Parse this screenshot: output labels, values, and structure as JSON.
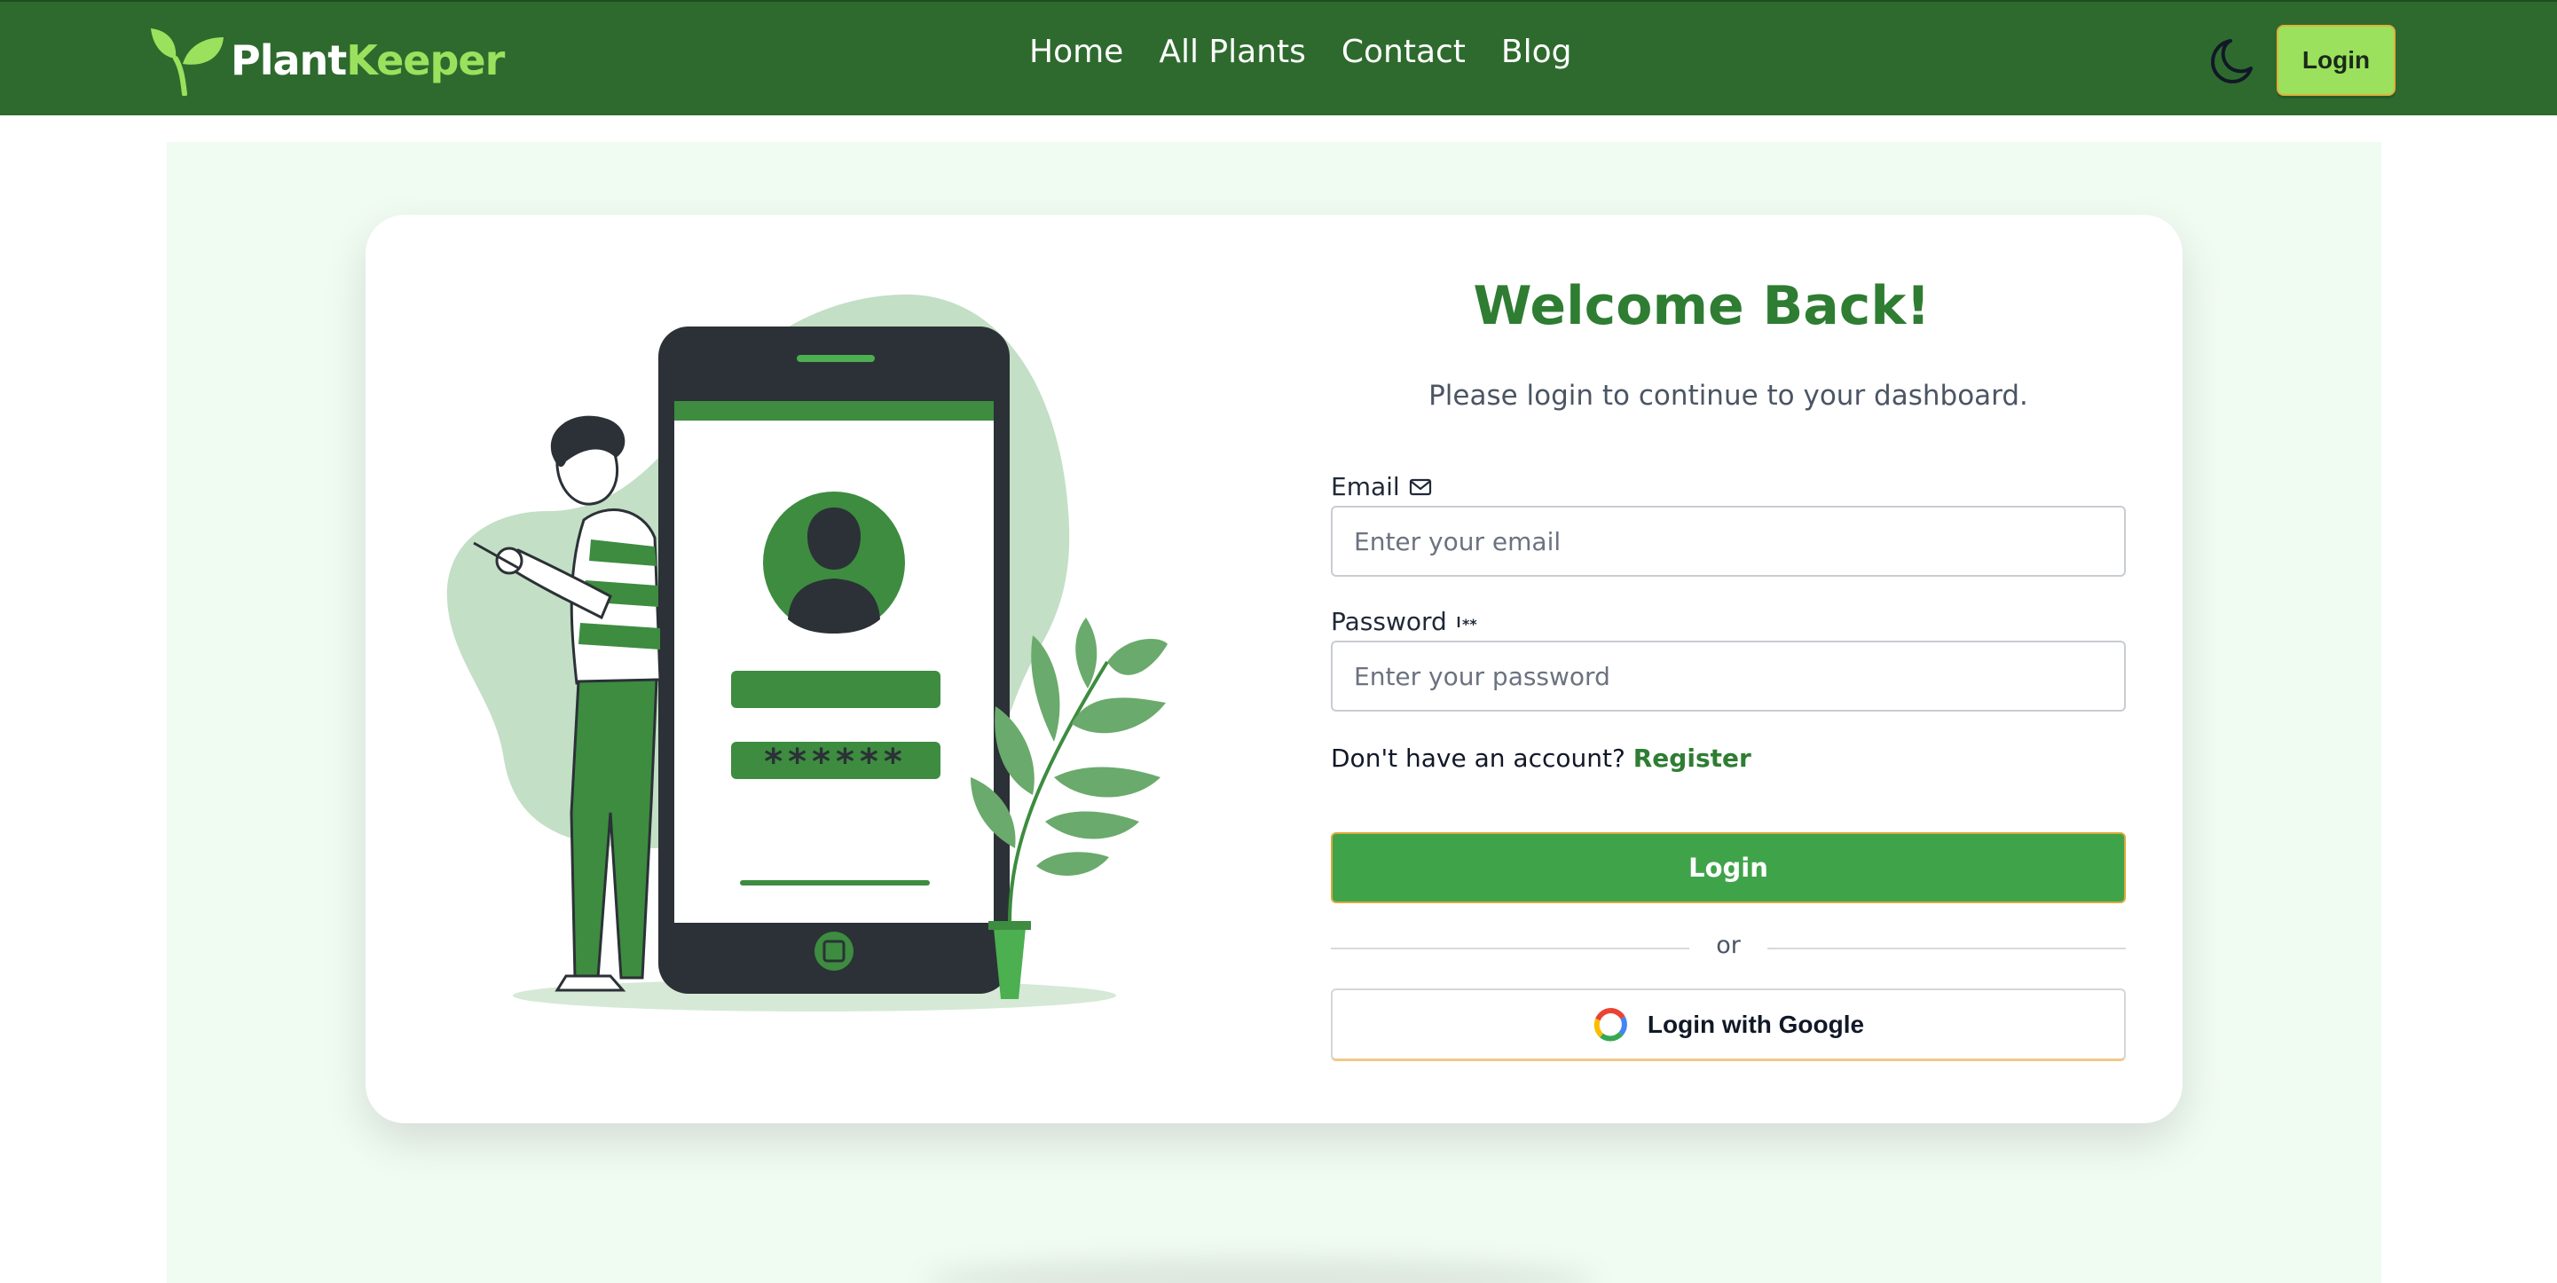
{
  "navbar": {
    "brand_part1": "Plant",
    "brand_part2": "Keeper",
    "links": [
      "Home",
      "All Plants",
      "Contact",
      "Blog"
    ],
    "theme_icon": "moon-icon",
    "login_label": "Login",
    "colors": {
      "background": "#2e6a2e",
      "accent": "#9be15d"
    }
  },
  "login_form": {
    "title": "Welcome Back!",
    "subtitle": "Please login to continue to your dashboard.",
    "email_label": "Email",
    "email_icon": "mail-icon",
    "email_placeholder": "Enter your email",
    "password_label": "Password",
    "password_icon": "password-dots-icon",
    "password_placeholder": "Enter your password",
    "register_prompt": "Don't have an account?",
    "register_link": "Register",
    "submit_label": "Login",
    "divider_text": "or",
    "google_label": "Login with Google",
    "google_icon": "google-icon",
    "colors": {
      "title": "#2e7d32",
      "button": "#3fa34a"
    }
  },
  "illustration": {
    "description_icon": "person-with-phone-illustration",
    "password_mask": "******"
  }
}
